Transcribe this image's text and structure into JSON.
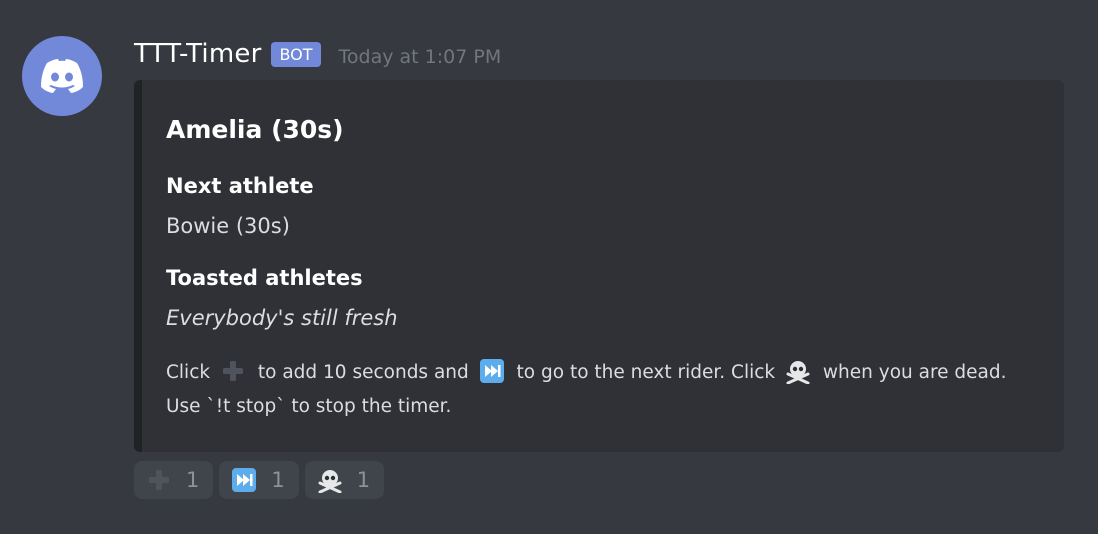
{
  "message": {
    "username": "TTT-Timer",
    "bot_tag": "BOT",
    "timestamp": "Today at 1:07 PM"
  },
  "embed": {
    "title": "Amelia (30s)",
    "fields": [
      {
        "name": "Next athlete",
        "value": "Bowie (30s)"
      },
      {
        "name": "Toasted athletes",
        "value": "Everybody's still fresh"
      }
    ],
    "description": {
      "part1": "Click",
      "part2": "to add 10 seconds and",
      "part3": "to go to the next rider. Click",
      "part4": "when you are dead.",
      "line2": "Use `!t stop` to stop the timer."
    }
  },
  "reactions": [
    {
      "icon": "plus-icon",
      "count": "1"
    },
    {
      "icon": "next-track-icon",
      "count": "1"
    },
    {
      "icon": "skull-crossbones-icon",
      "count": "1"
    }
  ],
  "colors": {
    "background": "#36393f",
    "embed_background": "#2f3136",
    "embed_border": "#202225",
    "blurple": "#7289da",
    "reaction_background": "#40444b"
  }
}
